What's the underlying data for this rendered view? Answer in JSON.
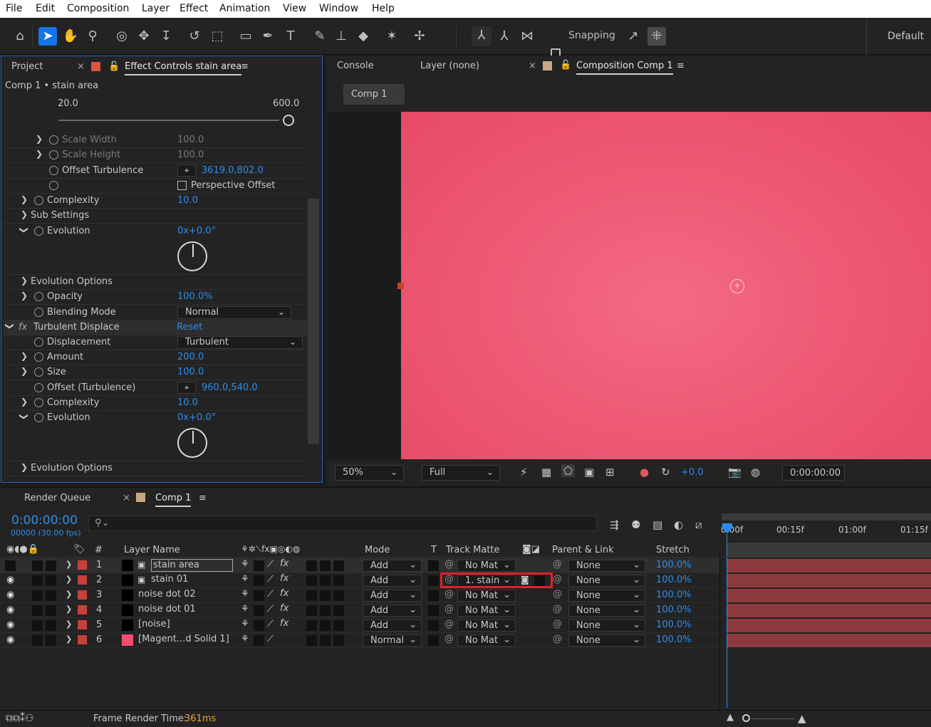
{
  "menu": [
    "File",
    "Edit",
    "Composition",
    "Layer",
    "Effect",
    "Animation",
    "View",
    "Window",
    "Help"
  ],
  "toolbar": {
    "snapping": "Snapping",
    "workspace": "Default"
  },
  "left": {
    "tab_project": "Project",
    "tab_effect": "Effect Controls stain area",
    "breadcrumb": "Comp 1 • stain area",
    "slider_min": "20.0",
    "slider_max": "600.0",
    "rows": [
      {
        "label": "Scale Width",
        "value": "100.0"
      },
      {
        "label": "Scale Height",
        "value": "100.0"
      },
      {
        "label": "Offset Turbulence",
        "value": "3619.0,802.0"
      },
      {
        "label": "Perspective Offset",
        "value": ""
      },
      {
        "label": "Complexity",
        "value": "10.0"
      },
      {
        "label": "Sub Settings",
        "value": ""
      },
      {
        "label": "Evolution",
        "value": "0x+0.0°"
      },
      {
        "label": "Evolution Options",
        "value": ""
      },
      {
        "label": "Opacity",
        "value": "100.0%"
      },
      {
        "label": "Blending Mode",
        "value": "Normal"
      },
      {
        "label": "Turbulent Displace",
        "value": "Reset"
      },
      {
        "label": "Displacement",
        "value": "Turbulent"
      },
      {
        "label": "Amount",
        "value": "200.0"
      },
      {
        "label": "Size",
        "value": "100.0"
      },
      {
        "label": "Offset (Turbulence)",
        "value": "960.0,540.0"
      },
      {
        "label": "Complexity",
        "value": "10.0"
      },
      {
        "label": "Evolution",
        "value": "0x+0.0°"
      },
      {
        "label": "Evolution Options",
        "value": ""
      }
    ]
  },
  "viewer": {
    "tab_console": "Console",
    "tab_layer": "Layer (none)",
    "tab_comp": "Composition Comp 1",
    "comp_button": "Comp 1",
    "zoom": "50%",
    "resolution": "Full",
    "exposure": "+0.0",
    "timecode": "0:00:00:00"
  },
  "timeline": {
    "tab_render": "Render Queue",
    "tab_comp": "Comp 1",
    "time": "0:00:00:00",
    "frames": "00000 (30.00 fps)",
    "ruler": [
      "0:00f",
      "00:15f",
      "01:00f",
      "01:15f"
    ],
    "headers": {
      "num": "#",
      "name": "Layer Name",
      "mode": "Mode",
      "t": "T",
      "matte": "Track Matte",
      "parent": "Parent & Link",
      "stretch": "Stretch"
    },
    "layers": [
      {
        "num": "1",
        "name": "stain area",
        "mode": "Add",
        "matte": "No Mat",
        "parent": "None",
        "stretch": "100.0%",
        "color": "#000000"
      },
      {
        "num": "2",
        "name": "stain 01",
        "mode": "Add",
        "matte": "1. stain",
        "parent": "None",
        "stretch": "100.0%",
        "color": "#000000"
      },
      {
        "num": "3",
        "name": "noise dot 02",
        "mode": "Add",
        "matte": "No Mat",
        "parent": "None",
        "stretch": "100.0%",
        "color": "#000000"
      },
      {
        "num": "4",
        "name": "noise dot 01",
        "mode": "Add",
        "matte": "No Mat",
        "parent": "None",
        "stretch": "100.0%",
        "color": "#000000"
      },
      {
        "num": "5",
        "name": "[noise]",
        "mode": "Add",
        "matte": "No Mat",
        "parent": "None",
        "stretch": "100.0%",
        "color": "#000000"
      },
      {
        "num": "6",
        "name": "[Magent...d Solid 1]",
        "mode": "Normal",
        "matte": "No Mat",
        "parent": "None",
        "stretch": "100.0%",
        "color": "#f0506e"
      }
    ],
    "footer_label": "Frame Render Time:",
    "footer_value": "361ms"
  },
  "colors": {
    "accent": "#2d8ceb",
    "highlight": "#e0202a",
    "comp_bg": "#ee5a75"
  }
}
